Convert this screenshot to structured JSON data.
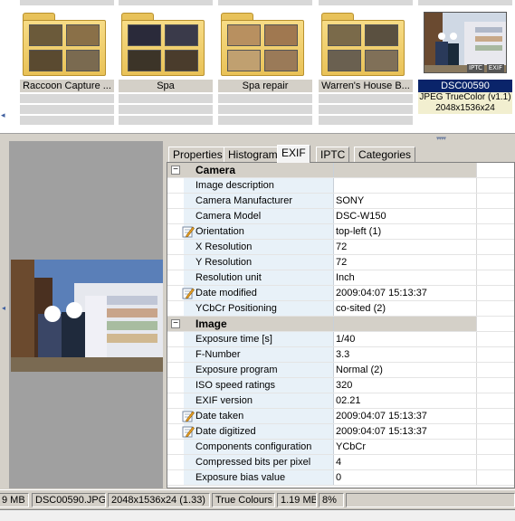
{
  "thumbnails": [
    {
      "label": "Raccoon Capture ...",
      "kind": "folder",
      "pics": [
        "#6b5a3a",
        "#8a7048",
        "#5a4a30",
        "#7a6a50"
      ]
    },
    {
      "label": "Spa",
      "kind": "folder",
      "pics": [
        "#2a2a3a",
        "#3a3a4a",
        "#3c3428",
        "#4a3c2c"
      ]
    },
    {
      "label": "Spa repair",
      "kind": "folder",
      "pics": [
        "#b89060",
        "#a07850",
        "#c0a070",
        "#9a7a58"
      ]
    },
    {
      "label": "Warren's House B...",
      "kind": "folder",
      "pics": [
        "#7a6a4a",
        "#5a5040",
        "#6a6050",
        "#807058"
      ]
    },
    {
      "label": "DSC00590",
      "kind": "photo",
      "subtitle": "JPEG TrueColor (v1.1)",
      "dimensions": "2048x1536x24",
      "badges": [
        "IPTC",
        "EXIF"
      ]
    }
  ],
  "tabs": [
    "Properties",
    "Histogram",
    "EXIF",
    "IPTC",
    "Categories"
  ],
  "active_tab": "EXIF",
  "exif": [
    {
      "type": "group",
      "name": "Camera",
      "expander": "−"
    },
    {
      "name": "Image description",
      "value": ""
    },
    {
      "name": "Camera Manufacturer",
      "value": "SONY"
    },
    {
      "name": "Camera Model",
      "value": "DSC-W150"
    },
    {
      "name": "Orientation",
      "value": "top-left (1)",
      "editable": true
    },
    {
      "name": "X Resolution",
      "value": "72"
    },
    {
      "name": "Y Resolution",
      "value": "72"
    },
    {
      "name": "Resolution unit",
      "value": "Inch"
    },
    {
      "name": "Date modified",
      "value": "2009:04:07 15:13:37",
      "editable": true
    },
    {
      "name": "YCbCr Positioning",
      "value": "co-sited (2)"
    },
    {
      "type": "group",
      "name": "Image",
      "expander": "−"
    },
    {
      "name": "Exposure time [s]",
      "value": "1/40"
    },
    {
      "name": "F-Number",
      "value": "3.3"
    },
    {
      "name": "Exposure program",
      "value": "Normal (2)"
    },
    {
      "name": "ISO speed ratings",
      "value": "320"
    },
    {
      "name": "EXIF version",
      "value": "02.21"
    },
    {
      "name": "Date taken",
      "value": "2009:04:07 15:13:37",
      "editable": true
    },
    {
      "name": "Date digitized",
      "value": "2009:04:07 15:13:37",
      "editable": true
    },
    {
      "name": "Components configuration",
      "value": "YCbCr"
    },
    {
      "name": "Compressed bits per pixel",
      "value": "4"
    },
    {
      "name": "Exposure bias value",
      "value": "0"
    }
  ],
  "statusbar": [
    "9 MB ]",
    "DSC00590.JPG",
    "2048x1536x24 (1.33)",
    "True Colours",
    "1.19 MB",
    "8%"
  ],
  "colors": {
    "selection": "#0a246a",
    "name_column_bg": "#e8f1f8",
    "panel_bg": "#d4d0c8",
    "preview_bg": "#a0a0a0",
    "folder": "#e9c257"
  },
  "icons": {
    "edit": "pencil-edit-icon",
    "expander": "minus-box-icon",
    "folder": "folder-icon"
  }
}
